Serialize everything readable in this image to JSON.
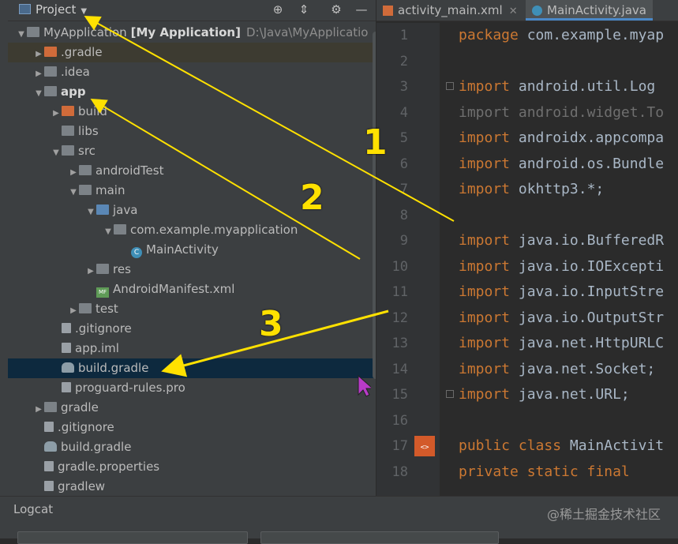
{
  "project_panel": {
    "title": "Project",
    "header_icons": [
      "target-icon",
      "collapse-all-icon",
      "gear-icon",
      "minimize-icon"
    ],
    "tree": [
      {
        "label": "MyApplication",
        "bold": "[My Application]",
        "path": "D:\\Java\\MyApplicatio",
        "icon": "module-icon",
        "arrow": "down"
      },
      {
        "label": ".gradle",
        "icon": "folder-orange",
        "arrow": "right"
      },
      {
        "label": ".idea",
        "icon": "folder-gray",
        "arrow": "right"
      },
      {
        "label": "app",
        "icon": "module-folder",
        "arrow": "down",
        "bold_only": true
      },
      {
        "label": "build",
        "icon": "folder-orange",
        "arrow": "right"
      },
      {
        "label": "libs",
        "icon": "folder-gray",
        "arrow": ""
      },
      {
        "label": "src",
        "icon": "folder-gray",
        "arrow": "down"
      },
      {
        "label": "androidTest",
        "icon": "folder-gray",
        "arrow": "right"
      },
      {
        "label": "main",
        "icon": "folder-gray",
        "arrow": "down"
      },
      {
        "label": "java",
        "icon": "folder-blue",
        "arrow": "down"
      },
      {
        "label": "com.example.myapplication",
        "icon": "package-icon",
        "arrow": "down"
      },
      {
        "label": "MainActivity",
        "icon": "class-icon",
        "arrow": ""
      },
      {
        "label": "res",
        "icon": "folder-gray",
        "arrow": "right"
      },
      {
        "label": "AndroidManifest.xml",
        "icon": "manifest-icon",
        "arrow": ""
      },
      {
        "label": "test",
        "icon": "folder-gray",
        "arrow": "right"
      },
      {
        "label": ".gitignore",
        "icon": "file-icon",
        "arrow": ""
      },
      {
        "label": "app.iml",
        "icon": "file-icon",
        "arrow": ""
      },
      {
        "label": "build.gradle",
        "icon": "gradle-icon",
        "arrow": ""
      },
      {
        "label": "proguard-rules.pro",
        "icon": "file-icon",
        "arrow": ""
      },
      {
        "label": "gradle",
        "icon": "folder-gray",
        "arrow": "right"
      },
      {
        "label": ".gitignore",
        "icon": "file-icon",
        "arrow": ""
      },
      {
        "label": "build.gradle",
        "icon": "gradle-icon",
        "arrow": ""
      },
      {
        "label": "gradle.properties",
        "icon": "file-icon",
        "arrow": ""
      },
      {
        "label": "gradlew",
        "icon": "file-icon",
        "arrow": ""
      }
    ]
  },
  "editor": {
    "tabs": [
      {
        "label": "activity_main.xml",
        "icon": "xml-icon",
        "active": false
      },
      {
        "label": "MainActivity.java",
        "icon": "class-icon",
        "active": true
      }
    ],
    "lines": [
      {
        "n": "1",
        "kw": "package",
        "rest": " com.example.myap"
      },
      {
        "n": "2",
        "kw": "",
        "rest": ""
      },
      {
        "n": "3",
        "kw": "import",
        "rest": " android.util.Log"
      },
      {
        "n": "4",
        "kw": "import",
        "rest": " android.widget.To",
        "dim": true
      },
      {
        "n": "5",
        "kw": "import",
        "rest": " androidx.appcompa"
      },
      {
        "n": "6",
        "kw": "import",
        "rest": " android.os.Bundle"
      },
      {
        "n": "7",
        "kw": "import",
        "rest": " okhttp3.*;"
      },
      {
        "n": "8",
        "kw": "",
        "rest": ""
      },
      {
        "n": "9",
        "kw": "import",
        "rest": " java.io.BufferedR"
      },
      {
        "n": "10",
        "kw": "import",
        "rest": " java.io.IOExcepti"
      },
      {
        "n": "11",
        "kw": "import",
        "rest": " java.io.InputStre"
      },
      {
        "n": "12",
        "kw": "import",
        "rest": " java.io.OutputStr"
      },
      {
        "n": "13",
        "kw": "import",
        "rest": " java.net.HttpURLC"
      },
      {
        "n": "14",
        "kw": "import",
        "rest": " java.net.Socket;"
      },
      {
        "n": "15",
        "kw": "import",
        "rest": " java.net.URL;"
      },
      {
        "n": "16",
        "kw": "",
        "rest": ""
      },
      {
        "n": "17",
        "kw": "public class",
        "rest": " MainActivit"
      },
      {
        "n": "18",
        "kw": "    private static final",
        "rest": ""
      }
    ]
  },
  "bottom_panel": {
    "title": "Logcat",
    "watermark": "@稀土掘金技术社区"
  },
  "annotations": {
    "labels": [
      "1",
      "2",
      "3"
    ],
    "color": "#ffe100"
  }
}
